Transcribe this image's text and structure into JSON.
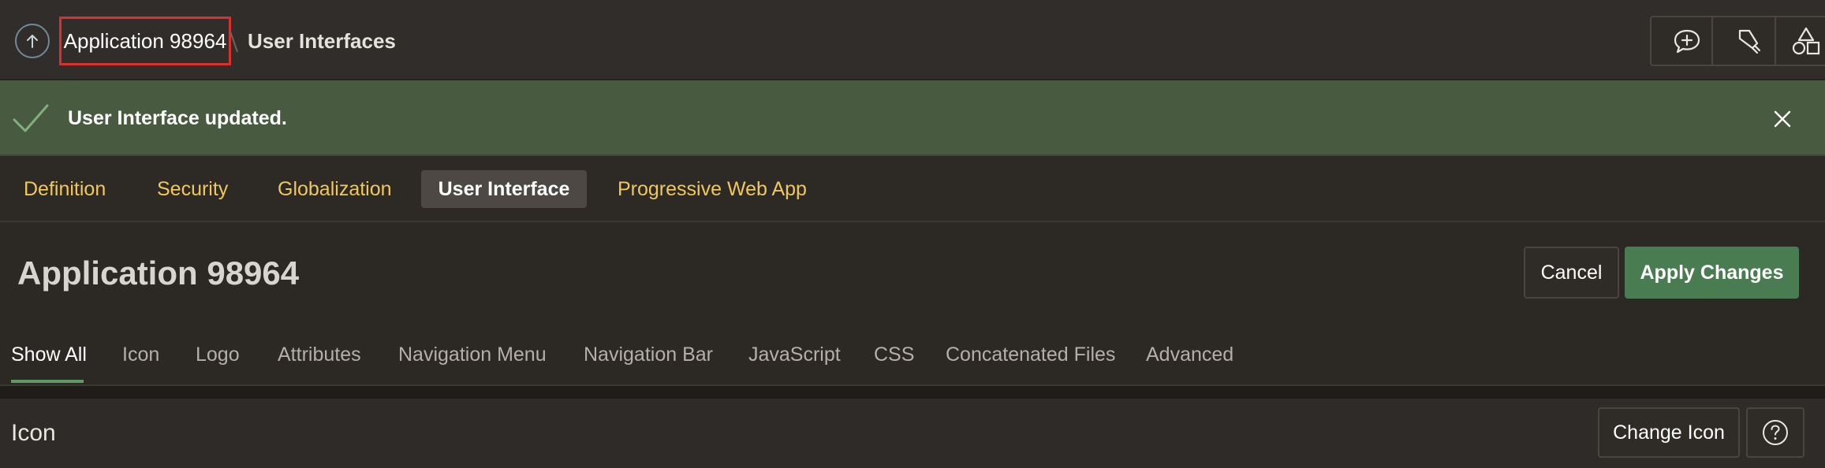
{
  "breadcrumb": {
    "current": "Application 98964",
    "next": "User Interfaces"
  },
  "toolbar": {
    "icons": [
      "add-comment-icon",
      "highlighter-icon",
      "shapes-icon"
    ]
  },
  "banner": {
    "message": "User Interface updated."
  },
  "page_tabs": [
    {
      "label": "Definition"
    },
    {
      "label": "Security"
    },
    {
      "label": "Globalization"
    },
    {
      "label": "User Interface",
      "active": true
    },
    {
      "label": "Progressive Web App"
    }
  ],
  "page": {
    "title": "Application 98964",
    "cancel_label": "Cancel",
    "apply_label": "Apply Changes"
  },
  "sub_tabs": [
    {
      "label": "Show All",
      "active": true
    },
    {
      "label": "Icon"
    },
    {
      "label": "Logo"
    },
    {
      "label": "Attributes"
    },
    {
      "label": "Navigation Menu"
    },
    {
      "label": "Navigation Bar"
    },
    {
      "label": "JavaScript"
    },
    {
      "label": "CSS"
    },
    {
      "label": "Concatenated Files"
    },
    {
      "label": "Advanced"
    }
  ],
  "region": {
    "title": "Icon",
    "change_label": "Change Icon"
  },
  "colors": {
    "success_banner": "#485a40",
    "tab_text": "#f0c85a",
    "apply_button": "#4a7c52",
    "highlight_border": "#d9302c",
    "active_underline": "#5d9a64"
  }
}
